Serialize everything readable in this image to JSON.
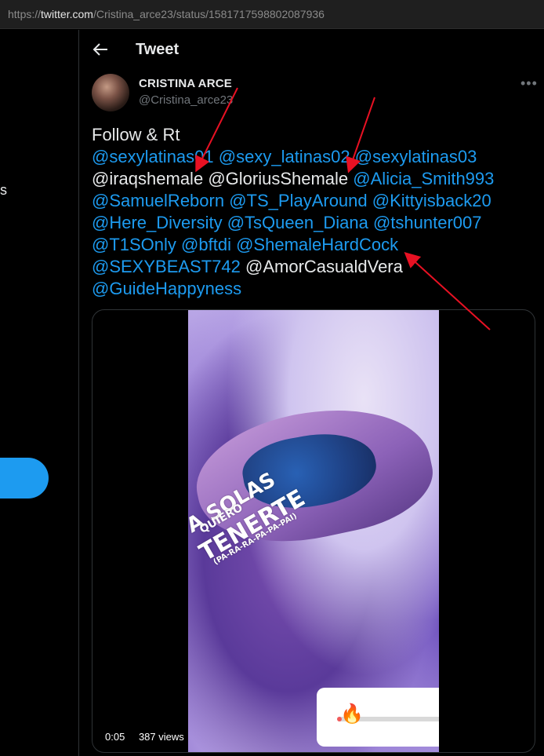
{
  "browser": {
    "url_prefix": "https://",
    "url_host": "twitter.com",
    "url_path": "/Cristina_arce23/status/1581717598802087936"
  },
  "left_nav": {
    "partial_label": "s"
  },
  "header": {
    "title": "Tweet"
  },
  "author": {
    "name": "CRISTINA ARCE",
    "handle": "@Cristina_arce23"
  },
  "tweet": {
    "lines": [
      [
        {
          "t": "Follow & Rt",
          "k": "text"
        }
      ],
      [
        {
          "t": "@sexylatinas01",
          "k": "link"
        },
        {
          "t": " ",
          "k": "text"
        },
        {
          "t": "@sexy_latinas02",
          "k": "link"
        },
        {
          "t": " ",
          "k": "text"
        },
        {
          "t": "@sexylatinas03",
          "k": "link"
        }
      ],
      [
        {
          "t": "@iraqshemale",
          "k": "text"
        },
        {
          "t": " ",
          "k": "text"
        },
        {
          "t": "@GloriusShemale",
          "k": "text"
        },
        {
          "t": " ",
          "k": "text"
        },
        {
          "t": "@Alicia_Smith993",
          "k": "link"
        }
      ],
      [
        {
          "t": "@SamuelReborn",
          "k": "link"
        },
        {
          "t": "  ",
          "k": "text"
        },
        {
          "t": "@TS_PlayAround",
          "k": "link"
        },
        {
          "t": " ",
          "k": "text"
        },
        {
          "t": "@Kittyisback20",
          "k": "link"
        }
      ],
      [
        {
          "t": "@Here_Diversity",
          "k": "link"
        },
        {
          "t": "  ",
          "k": "text"
        },
        {
          "t": "@TsQueen_Diana",
          "k": "link"
        },
        {
          "t": " ",
          "k": "text"
        },
        {
          "t": "@tshunter007",
          "k": "link"
        }
      ],
      [
        {
          "t": "@T1SOnly",
          "k": "link"
        },
        {
          "t": " ",
          "k": "text"
        },
        {
          "t": "@bftdi",
          "k": "link"
        },
        {
          "t": " ",
          "k": "text"
        },
        {
          "t": "@ShemaleHardCock",
          "k": "link"
        }
      ],
      [
        {
          "t": "@SEXYBEAST742",
          "k": "link"
        },
        {
          "t": " ",
          "k": "text"
        },
        {
          "t": "@AmorCasualdVera",
          "k": "text"
        }
      ],
      [
        {
          "t": "@GuideHappyness",
          "k": "link"
        }
      ]
    ]
  },
  "video": {
    "overlay_text": [
      "A SOLAS",
      "QUIERO",
      "TENERTE",
      "(PA-RA-RA-PA-PA-PAI)"
    ],
    "timestamp": "0:05",
    "views": "387 views",
    "progress": 0.03,
    "progress_icon": "fire-icon"
  },
  "colors": {
    "link": "#1d9bf0",
    "text": "#e7e9ea",
    "muted": "#71767b",
    "annotation_arrow": "#e81123"
  }
}
